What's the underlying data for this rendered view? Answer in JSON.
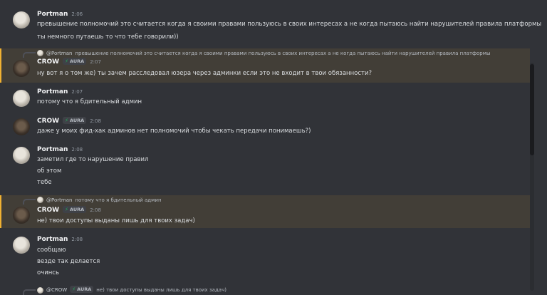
{
  "messages": [
    {
      "author": "Portman",
      "time": "2:06",
      "lines": [
        "превышение полномочий это считается когда я своими правами пользуюсь в своих интересах а не когда пытаюсь найти нарушителей правила платформы",
        "ты немного путаешь то что тебе говорили))"
      ]
    },
    {
      "reply": {
        "name": "@Portman",
        "text": "превышение полномочий это считается когда я своими правами пользуюсь в своих интересах а не когда пытаюсь найти нарушителей правила платформы"
      },
      "author": "CROW",
      "badge": "AURA",
      "time": "2:07",
      "lines": [
        "ну вот я о том же) ты зачем расследовал юзера через админки если это не входит в твои обязанности?"
      ]
    },
    {
      "author": "Portman",
      "time": "2:07",
      "lines": [
        "потому что я бдительный админ"
      ]
    },
    {
      "author": "CROW",
      "badge": "AURA",
      "time": "2:08",
      "lines": [
        "даже у моих фид-хак админов нет полномочий чтобы чекать передачи понимаешь?)"
      ]
    },
    {
      "author": "Portman",
      "time": "2:08",
      "lines": [
        "заметил где то нарушение правил",
        "об этом",
        "тебе"
      ]
    },
    {
      "reply": {
        "name": "@Portman",
        "text": "потому что я бдительный админ"
      },
      "author": "CROW",
      "badge": "AURA",
      "time": "2:08",
      "lines": [
        "не) твои доступы выданы лишь для твоих задач)"
      ]
    },
    {
      "author": "Portman",
      "time": "2:08",
      "lines": [
        "сообщаю",
        "везде так делается",
        "очинсь"
      ]
    },
    {
      "reply": {
        "name": "@CROW",
        "badge": "AURA",
        "text": "не) твои доступы выданы лишь для твоих задач)"
      }
    }
  ]
}
